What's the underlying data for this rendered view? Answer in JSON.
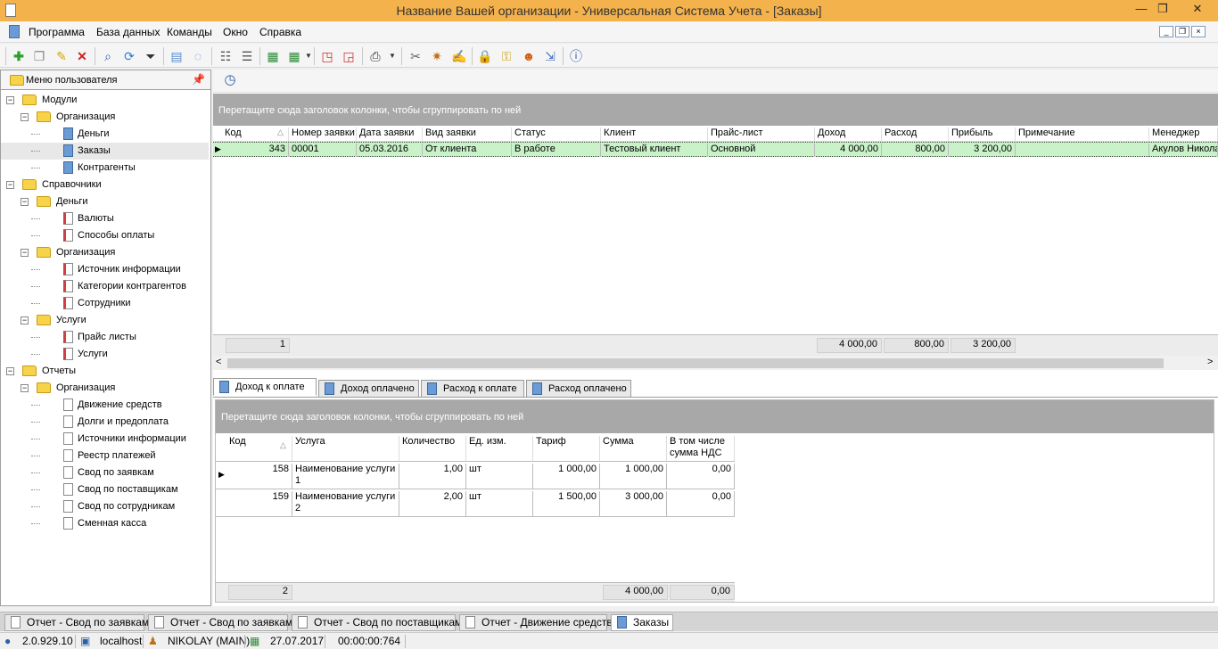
{
  "window": {
    "title": "Название Вашей организации - Универсальная Система Учета - [Заказы]",
    "minimize": "—",
    "maximize": "❐",
    "close": "✕"
  },
  "menu": [
    "Программа",
    "База данных",
    "Команды",
    "Окно",
    "Справка"
  ],
  "mdi_buttons": [
    "_",
    "❐",
    "×"
  ],
  "left_panel": {
    "title": "Меню пользователя",
    "pin": "📌",
    "tree": [
      {
        "label": "Модули",
        "level": 0,
        "icon": "folder",
        "expander": "−"
      },
      {
        "label": "Организация",
        "level": 1,
        "icon": "folder",
        "expander": "−"
      },
      {
        "label": "Деньги",
        "level": 2,
        "icon": "docb"
      },
      {
        "label": "Заказы",
        "level": 2,
        "icon": "docb",
        "selected": true
      },
      {
        "label": "Контрагенты",
        "level": 2,
        "icon": "docb"
      },
      {
        "label": "Справочники",
        "level": 0,
        "icon": "folder",
        "expander": "−"
      },
      {
        "label": "Деньги",
        "level": 1,
        "icon": "folder",
        "expander": "−"
      },
      {
        "label": "Валюты",
        "level": 2,
        "icon": "docr"
      },
      {
        "label": "Способы оплаты",
        "level": 2,
        "icon": "docr"
      },
      {
        "label": "Организация",
        "level": 1,
        "icon": "folder",
        "expander": "−"
      },
      {
        "label": "Источник информации",
        "level": 2,
        "icon": "docr"
      },
      {
        "label": "Категории контрагентов",
        "level": 2,
        "icon": "docr"
      },
      {
        "label": "Сотрудники",
        "level": 2,
        "icon": "docr"
      },
      {
        "label": "Услуги",
        "level": 1,
        "icon": "folder",
        "expander": "−"
      },
      {
        "label": "Прайс листы",
        "level": 2,
        "icon": "docr"
      },
      {
        "label": "Услуги",
        "level": 2,
        "icon": "docr"
      },
      {
        "label": "Отчеты",
        "level": 0,
        "icon": "folder",
        "expander": "−"
      },
      {
        "label": "Организация",
        "level": 1,
        "icon": "folder",
        "expander": "−"
      },
      {
        "label": "Движение средств",
        "level": 2,
        "icon": "docw"
      },
      {
        "label": "Долги и предоплата",
        "level": 2,
        "icon": "docw"
      },
      {
        "label": "Источники информации",
        "level": 2,
        "icon": "docw"
      },
      {
        "label": "Реестр платежей",
        "level": 2,
        "icon": "docw"
      },
      {
        "label": "Свод по заявкам",
        "level": 2,
        "icon": "docw"
      },
      {
        "label": "Свод по поставщикам",
        "level": 2,
        "icon": "docw"
      },
      {
        "label": "Свод по сотрудникам",
        "level": 2,
        "icon": "docw"
      },
      {
        "label": "Сменная касса",
        "level": 2,
        "icon": "docw"
      }
    ]
  },
  "orders_grid": {
    "group_hint": "Перетащите сюда заголовок колонки, чтобы сгруппировать по ней",
    "sort_glyph": "△",
    "row_marker": "▶",
    "columns": [
      "Код",
      "Номер заявки",
      "Дата заявки",
      "Вид заявки",
      "Статус",
      "Клиент",
      "Прайс-лист",
      "Доход",
      "Расход",
      "Прибыль",
      "Примечание",
      "Менеджер"
    ],
    "rows": [
      [
        "343",
        "00001",
        "05.03.2016",
        "От клиента",
        "В работе",
        "Тестовый клиент",
        "Основной",
        "4 000,00",
        "800,00",
        "3 200,00",
        "",
        "Акулов Николай"
      ]
    ],
    "footer": {
      "count": "1",
      "income": "4 000,00",
      "expense": "800,00",
      "profit": "3 200,00"
    },
    "scroll_left": "<",
    "scroll_right": ">"
  },
  "detail_tabs": [
    "Доход к оплате",
    "Доход оплачено",
    "Расход к оплате",
    "Расход оплачено"
  ],
  "detail_grid": {
    "group_hint": "Перетащите сюда заголовок колонки, чтобы сгруппировать по ней",
    "columns": [
      "Код",
      "Услуга",
      "Количество",
      "Ед. изм.",
      "Тариф",
      "Сумма",
      "В том числе сумма НДС"
    ],
    "rows": [
      {
        "code": "158",
        "service_l1": "Наименование услуги",
        "service_l2": "1",
        "qty": "1,00",
        "unit": "шт",
        "rate": "1 000,00",
        "sum": "1 000,00",
        "vat": "0,00"
      },
      {
        "code": "159",
        "service_l1": "Наименование услуги",
        "service_l2": "2",
        "qty": "2,00",
        "unit": "шт",
        "rate": "1 500,00",
        "sum": "3 000,00",
        "vat": "0,00"
      }
    ],
    "footer": {
      "count": "2",
      "sum": "4 000,00",
      "vat": "0,00"
    }
  },
  "window_tabs": [
    "Отчет - Свод по заявкам",
    "Отчет - Свод по заявкам",
    "Отчет - Свод по поставщикам",
    "Отчет - Движение средств",
    "Заказы"
  ],
  "status": {
    "version": "2.0.929.10",
    "server": "localhost",
    "user": "NIKOLAY (MAIN)",
    "date": "27.07.2017",
    "timer": "00:00:00:764"
  },
  "colors": {
    "title_bar": "#f3b24b",
    "selected_row": "#c9f2c9",
    "group_panel": "#a8a8a8"
  }
}
